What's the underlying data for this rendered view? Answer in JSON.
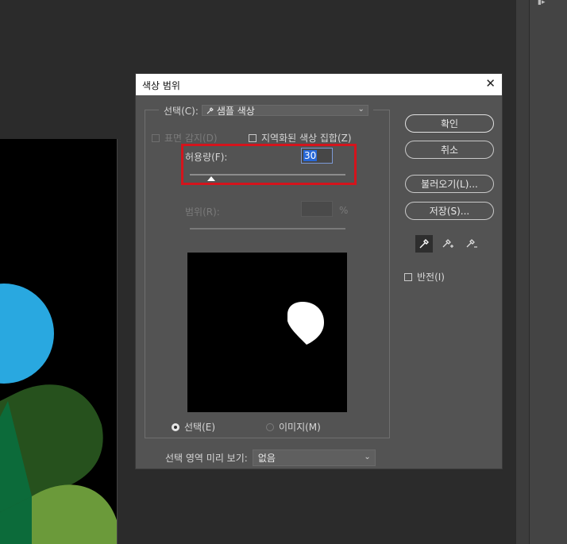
{
  "dialog": {
    "title": "색상 범위",
    "close": "✕",
    "select_label": "선택(C):",
    "select_value": "샘플 색상",
    "select_chevron": "⌄",
    "detect_faces": "표면 감지(D)",
    "localized_clusters": "지역화된 색상 집합(Z)",
    "fuzziness_label": "허용량(F):",
    "fuzziness_value": "30",
    "fuzziness_level": 0.14,
    "range_label": "범위(R):",
    "range_unit": "%",
    "radio_selection": "선택(E)",
    "radio_image": "이미지(M)",
    "invert_label": "반전(I)",
    "preview_label": "선택 영역 미리 보기:",
    "preview_value": "없음",
    "preview_chevron": "⌄"
  },
  "buttons": {
    "ok": "확인",
    "cancel": "취소",
    "load": "불러오기(L)...",
    "save": "저장(S)..."
  },
  "tools": [
    "eyedropper-icon",
    "eyedropper-plus-icon",
    "eyedropper-minus-icon"
  ],
  "colors": {
    "dialog_bg": "#535353",
    "highlight": "#d4141c",
    "input_selection": "#2768d8",
    "leaf_blue": "#29a8e0",
    "leaf_dark_green": "#26511d",
    "leaf_green": "#0c6b3a",
    "leaf_olive": "#6b9a3a"
  }
}
